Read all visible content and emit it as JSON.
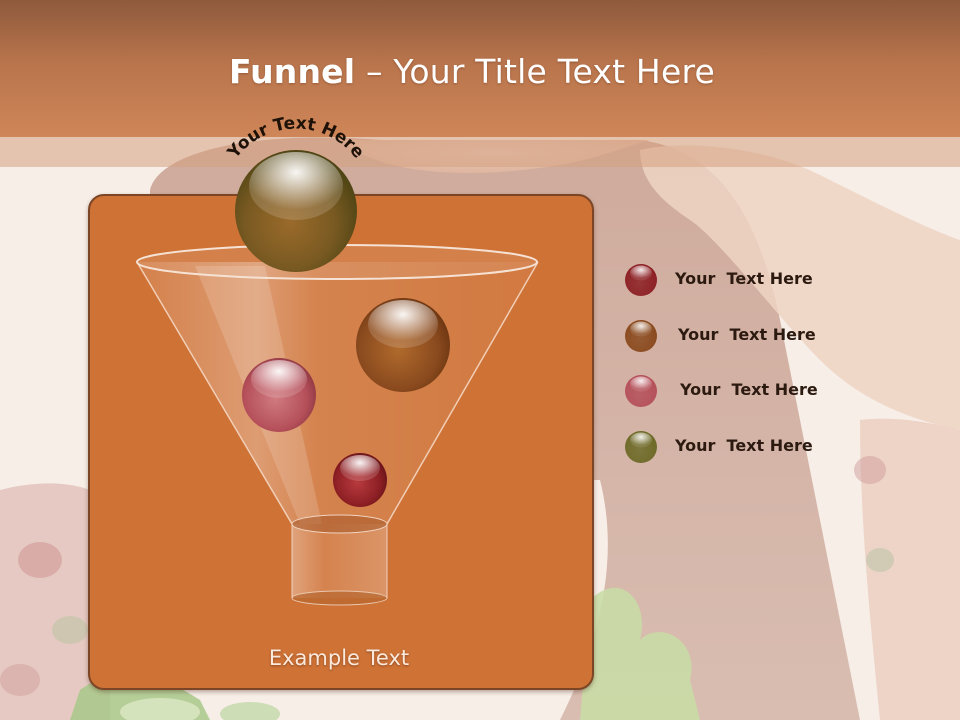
{
  "slide": {
    "title_bold": "Funnel",
    "title_rest": " – Your Title Text Here",
    "arc_label": "Your Text Here",
    "panel_caption": "Example Text"
  },
  "legend": [
    {
      "label": "Your  Text Here",
      "color": "#8c1f24"
    },
    {
      "label": "Your  Text Here",
      "color": "#8a4a1e"
    },
    {
      "label": "Your  Text Here",
      "color": "#b5505a"
    },
    {
      "label": "Your  Text Here",
      "color": "#6e6a28"
    }
  ],
  "colors": {
    "header": "#b8744c",
    "panel": "#cf7236",
    "panel_border": "#7c4626",
    "title_text": "#ffffff"
  },
  "icons": {
    "legend_marker": "glossy-sphere-icon",
    "top_sphere": "glossy-sphere-icon"
  }
}
